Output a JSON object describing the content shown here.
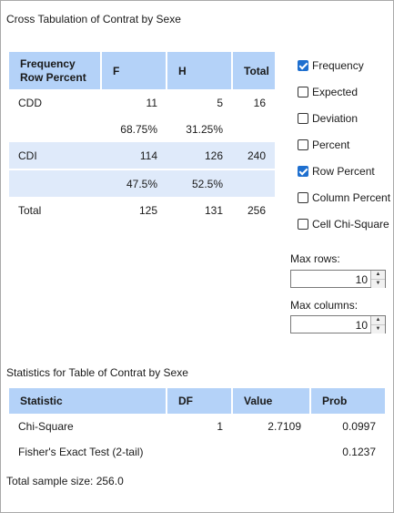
{
  "crosstab": {
    "title": "Cross Tabulation of Contrat by Sexe",
    "header": {
      "label_line1": "Frequency",
      "label_line2": "Row Percent",
      "col1": "F",
      "col2": "H",
      "total": "Total"
    },
    "rows": [
      {
        "label": "CDD",
        "f": "11",
        "h": "5",
        "total": "16",
        "f_pct": "68.75%",
        "h_pct": "31.25%"
      },
      {
        "label": "CDI",
        "f": "114",
        "h": "126",
        "total": "240",
        "f_pct": "47.5%",
        "h_pct": "52.5%"
      }
    ],
    "total_row": {
      "label": "Total",
      "f": "125",
      "h": "131",
      "total": "256"
    }
  },
  "options": {
    "items": [
      {
        "label": "Frequency",
        "checked": true
      },
      {
        "label": "Expected",
        "checked": false
      },
      {
        "label": "Deviation",
        "checked": false
      },
      {
        "label": "Percent",
        "checked": false
      },
      {
        "label": "Row Percent",
        "checked": true
      },
      {
        "label": "Column Percent",
        "checked": false
      },
      {
        "label": "Cell Chi-Square",
        "checked": false
      }
    ],
    "max_rows_label": "Max rows:",
    "max_rows": "10",
    "max_cols_label": "Max columns:",
    "max_cols": "10"
  },
  "stats": {
    "title": "Statistics for Table of Contrat by Sexe",
    "headers": [
      "Statistic",
      "DF",
      "Value",
      "Prob"
    ],
    "rows": [
      {
        "statistic": "Chi-Square",
        "df": "1",
        "value": "2.7109",
        "prob": "0.0997"
      },
      {
        "statistic": "Fisher's Exact Test (2-tail)",
        "df": "",
        "value": "",
        "prob": "0.1237"
      }
    ],
    "sample_size": "Total sample size: 256.0"
  },
  "colors": {
    "header_bg": "#b4d2f8",
    "band_bg": "#dfeafa",
    "check": "#1e6fcf"
  }
}
